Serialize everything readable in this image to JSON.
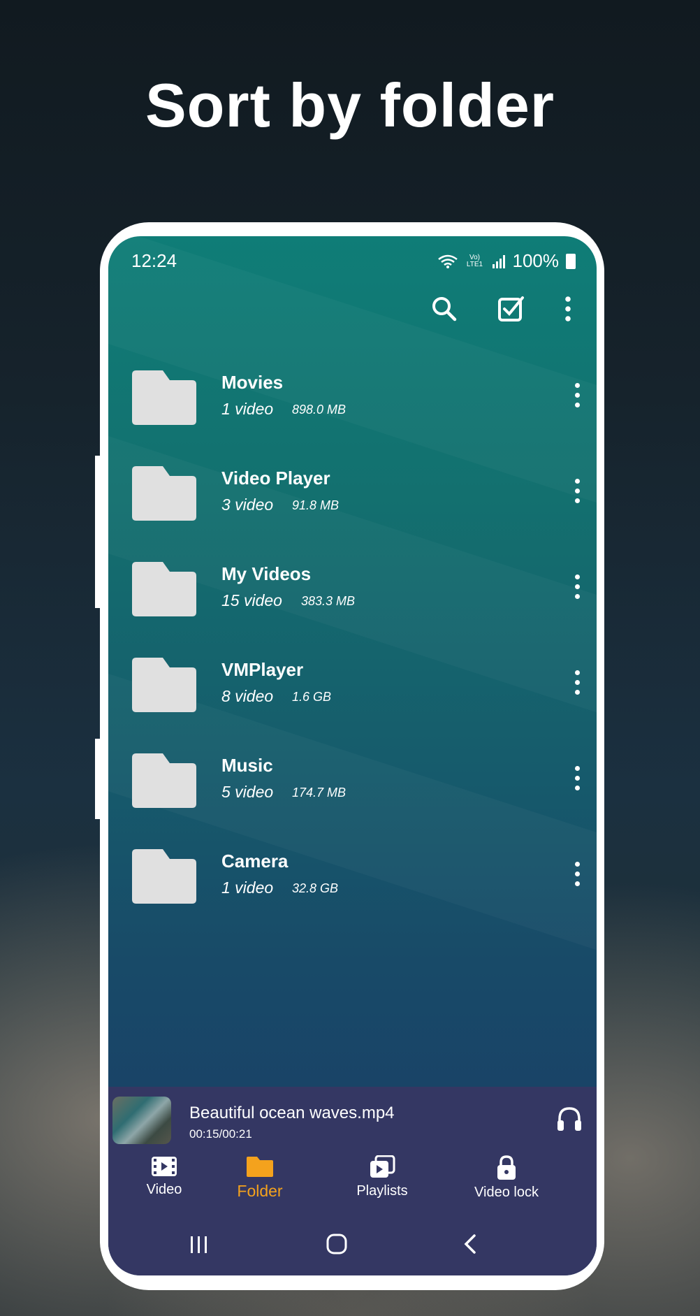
{
  "headline": "Sort by folder",
  "status_bar": {
    "time": "12:24",
    "network_label": "Vo) LTE1",
    "battery": "100%"
  },
  "toolbar": {
    "icons": [
      "search-icon",
      "select-all-icon",
      "more-vertical-icon"
    ]
  },
  "folders": [
    {
      "name": "Movies",
      "count": "1 video",
      "size": "898.0 MB"
    },
    {
      "name": "Video Player",
      "count": "3 video",
      "size": "91.8 MB"
    },
    {
      "name": "My Videos",
      "count": "15 video",
      "size": "383.3 MB"
    },
    {
      "name": "VMPlayer",
      "count": "8 video",
      "size": "1.6 GB"
    },
    {
      "name": "Music",
      "count": "5 video",
      "size": "174.7 MB"
    },
    {
      "name": "Camera",
      "count": "1 video",
      "size": "32.8 GB"
    }
  ],
  "now_playing": {
    "title": "Beautiful ocean waves.mp4",
    "time": "00:15/00:21"
  },
  "bottom_nav": [
    {
      "label": "Video",
      "icon": "film-icon",
      "active": false
    },
    {
      "label": "Folder",
      "icon": "folder-icon",
      "active": true
    },
    {
      "label": "Playlists",
      "icon": "playlist-icon",
      "active": false
    },
    {
      "label": "Video lock",
      "icon": "lock-icon",
      "active": false
    }
  ],
  "colors": {
    "accent": "#f4a21d",
    "screen_top": "#0f7d77",
    "screen_bottom": "#1b3a66",
    "bottom_bar": "#343763",
    "folder_icon": "#e0e0e0"
  }
}
